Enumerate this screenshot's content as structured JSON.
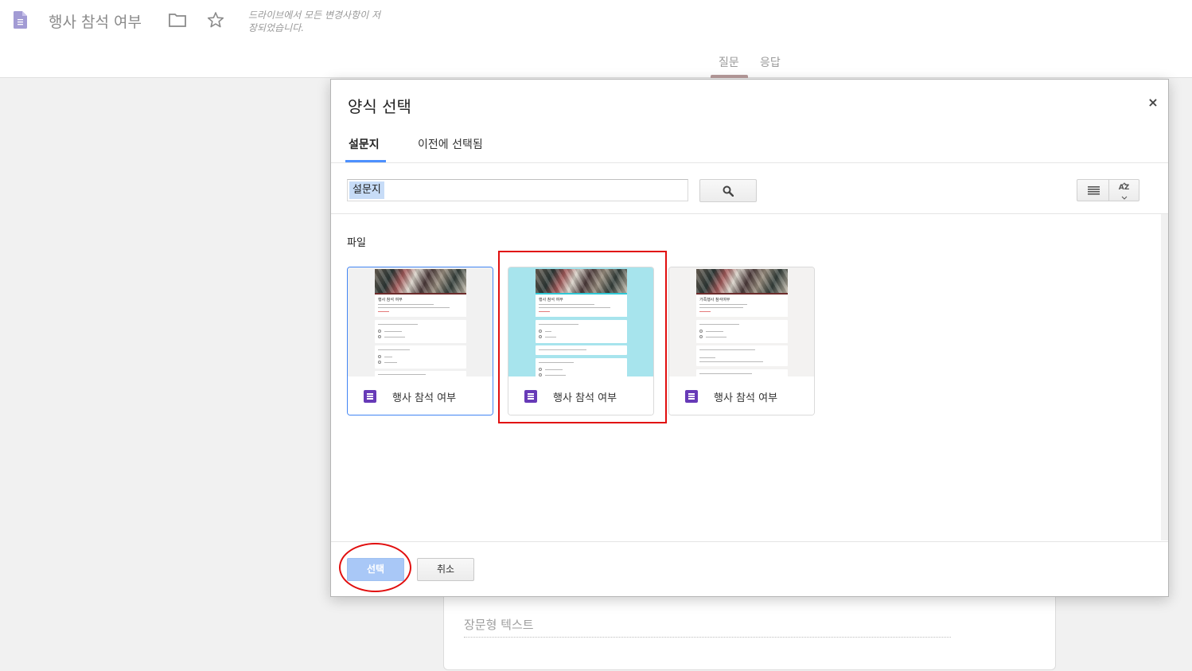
{
  "header": {
    "doc_title": "행사 참석 여부",
    "save_status": "드라이브에서 모든 변경사항이 저장되었습니다.",
    "tabs": [
      {
        "label": "질문"
      },
      {
        "label": "응답"
      }
    ]
  },
  "background_card": {
    "placeholder": "장문형 텍스트"
  },
  "dialog": {
    "title": "양식 선택",
    "close_symbol": "×",
    "tabs": [
      {
        "label": "설문지",
        "active": true
      },
      {
        "label": "이전에 선택됨",
        "active": false
      }
    ],
    "search": {
      "value": "설문지"
    },
    "sort_label": "AZ",
    "section_label": "파일",
    "files": [
      {
        "name": "행사 참석 여부",
        "thumbnail": {
          "form_title": "행사 참석 여부",
          "theme_color": "#6d2b2b",
          "background": "#f1f1f1"
        }
      },
      {
        "name": "행사 참석 여부",
        "thumbnail": {
          "form_title": "행사 참석 여부",
          "theme_color": "#30c8d6",
          "background": "#a7e4ed"
        }
      },
      {
        "name": "행사 참석 여부",
        "thumbnail": {
          "form_title": "가족행사 참석여부",
          "theme_color": "#6d2b2b",
          "background": "#f3f2f1"
        }
      }
    ],
    "buttons": {
      "select": "선택",
      "cancel": "취소"
    }
  },
  "colors": {
    "accent_blue": "#4285f4",
    "forms_purple": "#673ab7",
    "annotation_red": "#e10e0e"
  }
}
